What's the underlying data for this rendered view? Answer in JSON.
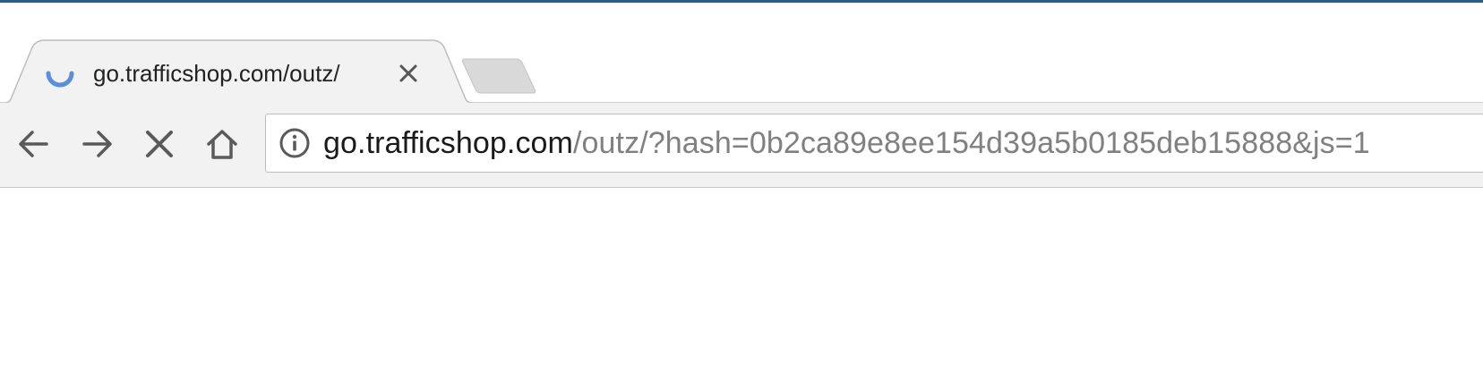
{
  "tab": {
    "title": "go.trafficshop.com/outz/",
    "loading": true,
    "spinner_color": "#5b8fd8",
    "close_icon": "close-icon"
  },
  "new_tab": {
    "icon": "new-tab-icon"
  },
  "toolbar": {
    "back_icon": "arrow-left-icon",
    "forward_icon": "arrow-right-icon",
    "stop_icon": "close-icon",
    "home_icon": "home-icon"
  },
  "omnibox": {
    "security_icon": "info-icon",
    "url_host": "go.trafficshop.com",
    "url_path": "/outz/?hash=0b2ca89e8ee154d39a5b0185deb15888&js=1"
  },
  "colors": {
    "window_frame": "#2b5b86",
    "toolbar_bg": "#f2f2f2",
    "icon_gray": "#5a5a5a"
  }
}
